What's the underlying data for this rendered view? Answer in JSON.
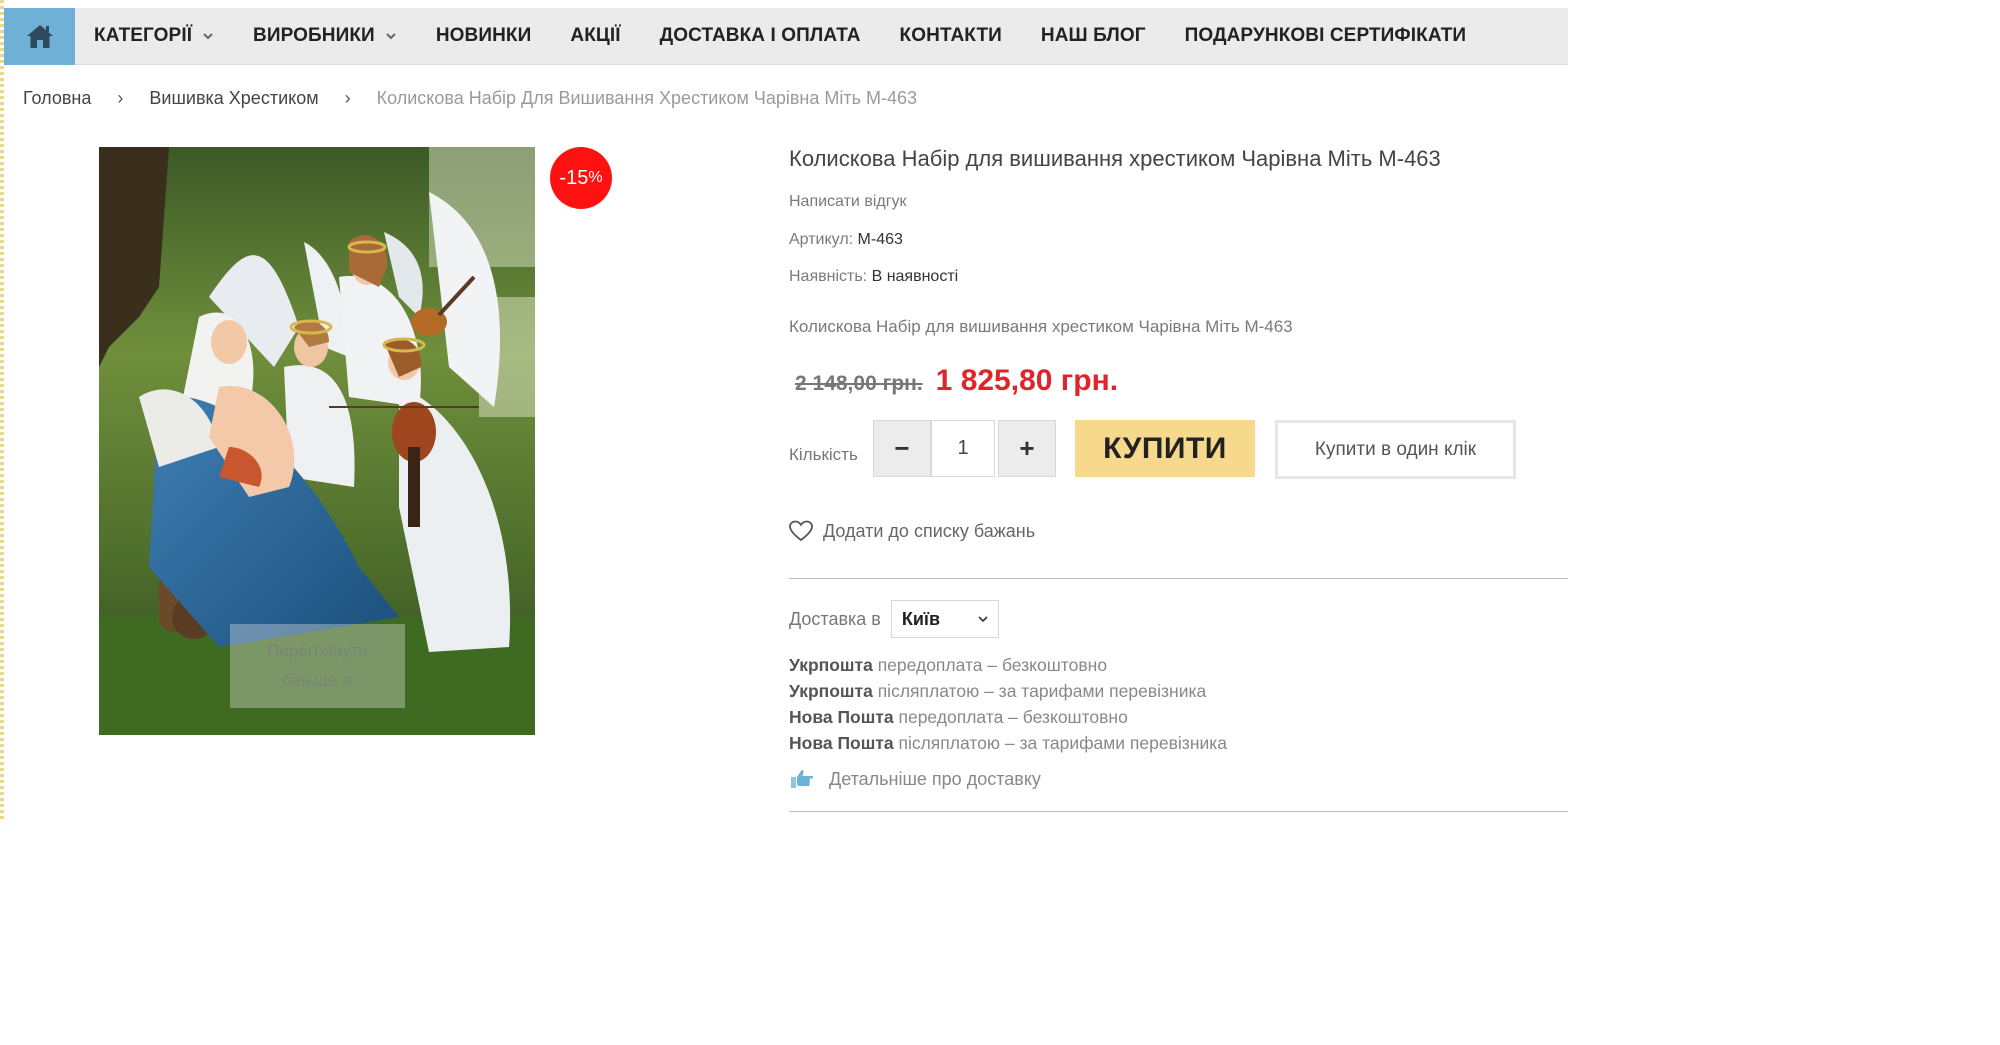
{
  "nav": {
    "home_icon": "home-icon",
    "items": [
      {
        "label": "КАТЕГОРІЇ",
        "dropdown": true
      },
      {
        "label": "ВИРОБНИКИ",
        "dropdown": true
      },
      {
        "label": "НОВИНКИ",
        "dropdown": false
      },
      {
        "label": "АКЦІЇ",
        "dropdown": false
      },
      {
        "label": "ДОСТАВКА І ОПЛАТА",
        "dropdown": false
      },
      {
        "label": "КОНТАКТИ",
        "dropdown": false
      },
      {
        "label": "НАШ БЛОГ",
        "dropdown": false
      },
      {
        "label": "ПОДАРУНКОВІ СЕРТИФІКАТИ",
        "dropdown": false
      }
    ]
  },
  "breadcrumb": {
    "home": "Головна",
    "category": "Вишивка Хрестиком",
    "current": "Колискова Набір Для Вишивання Хрестиком Чарівна Міть М-463",
    "separator": "›"
  },
  "image": {
    "view_more": "Переглянути більше",
    "view_more_icon": "plus-circle-icon"
  },
  "badge": {
    "value": "-15",
    "unit": "%"
  },
  "product": {
    "title": "Колискова Набір для вишивання хрестиком Чарівна Міть М-463",
    "review_link": "Написати відгук",
    "sku_label": "Артикул:",
    "sku": "М-463",
    "stock_label": "Наявність:",
    "stock": "В наявності",
    "short_description": "Колискова Набір для вишивання хрестиком Чарівна Міть М-463",
    "old_price": "2 148,00 грн.",
    "price": "1 825,80 грн."
  },
  "purchase": {
    "qty_label": "Кількість",
    "qty_value": "1",
    "minus": "−",
    "plus": "+",
    "buy": "КУПИТИ",
    "one_click": "Купити в один клік",
    "wishlist": "Додати до списку бажань"
  },
  "delivery": {
    "label": "Доставка в",
    "city": "Київ",
    "options": [
      {
        "carrier": "Укрпошта",
        "condition": "передоплата – безкоштовно"
      },
      {
        "carrier": "Укрпошта",
        "condition": "післяплатою – за тарифами перевізника"
      },
      {
        "carrier": "Нова Пошта",
        "condition": "передоплата – безкоштовно"
      },
      {
        "carrier": "Нова Пошта",
        "condition": "післяплатою – за тарифами перевізника"
      }
    ],
    "more_link": "Детальніше про доставку"
  },
  "colors": {
    "home_button": "#6fb1d6",
    "price_red": "#e0242b",
    "badge_red": "#ff1111",
    "buy_button": "#f6d98d"
  }
}
